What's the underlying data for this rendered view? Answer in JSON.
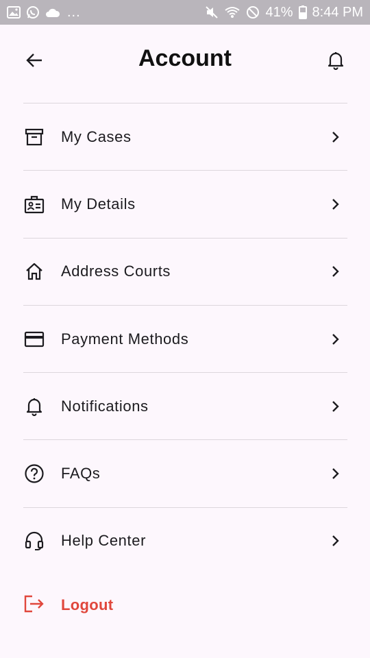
{
  "status_bar": {
    "battery": "41%",
    "time": "8:44 PM",
    "more": "..."
  },
  "header": {
    "title": "Account"
  },
  "menu": {
    "items": [
      {
        "label": "My Cases",
        "icon": "archive-box-icon"
      },
      {
        "label": "My Details",
        "icon": "id-badge-icon"
      },
      {
        "label": "Address Courts",
        "icon": "home-icon"
      },
      {
        "label": "Payment Methods",
        "icon": "credit-card-icon"
      },
      {
        "label": "Notifications",
        "icon": "bell-icon"
      },
      {
        "label": "FAQs",
        "icon": "question-circle-icon"
      },
      {
        "label": "Help Center",
        "icon": "headset-icon"
      }
    ]
  },
  "logout": {
    "label": "Logout",
    "color": "#e0473c"
  },
  "colors": {
    "background": "#fdf7fd",
    "status_bar": "#b9b5bb",
    "divider": "#dcd6dc",
    "text": "#1c1b1f"
  }
}
